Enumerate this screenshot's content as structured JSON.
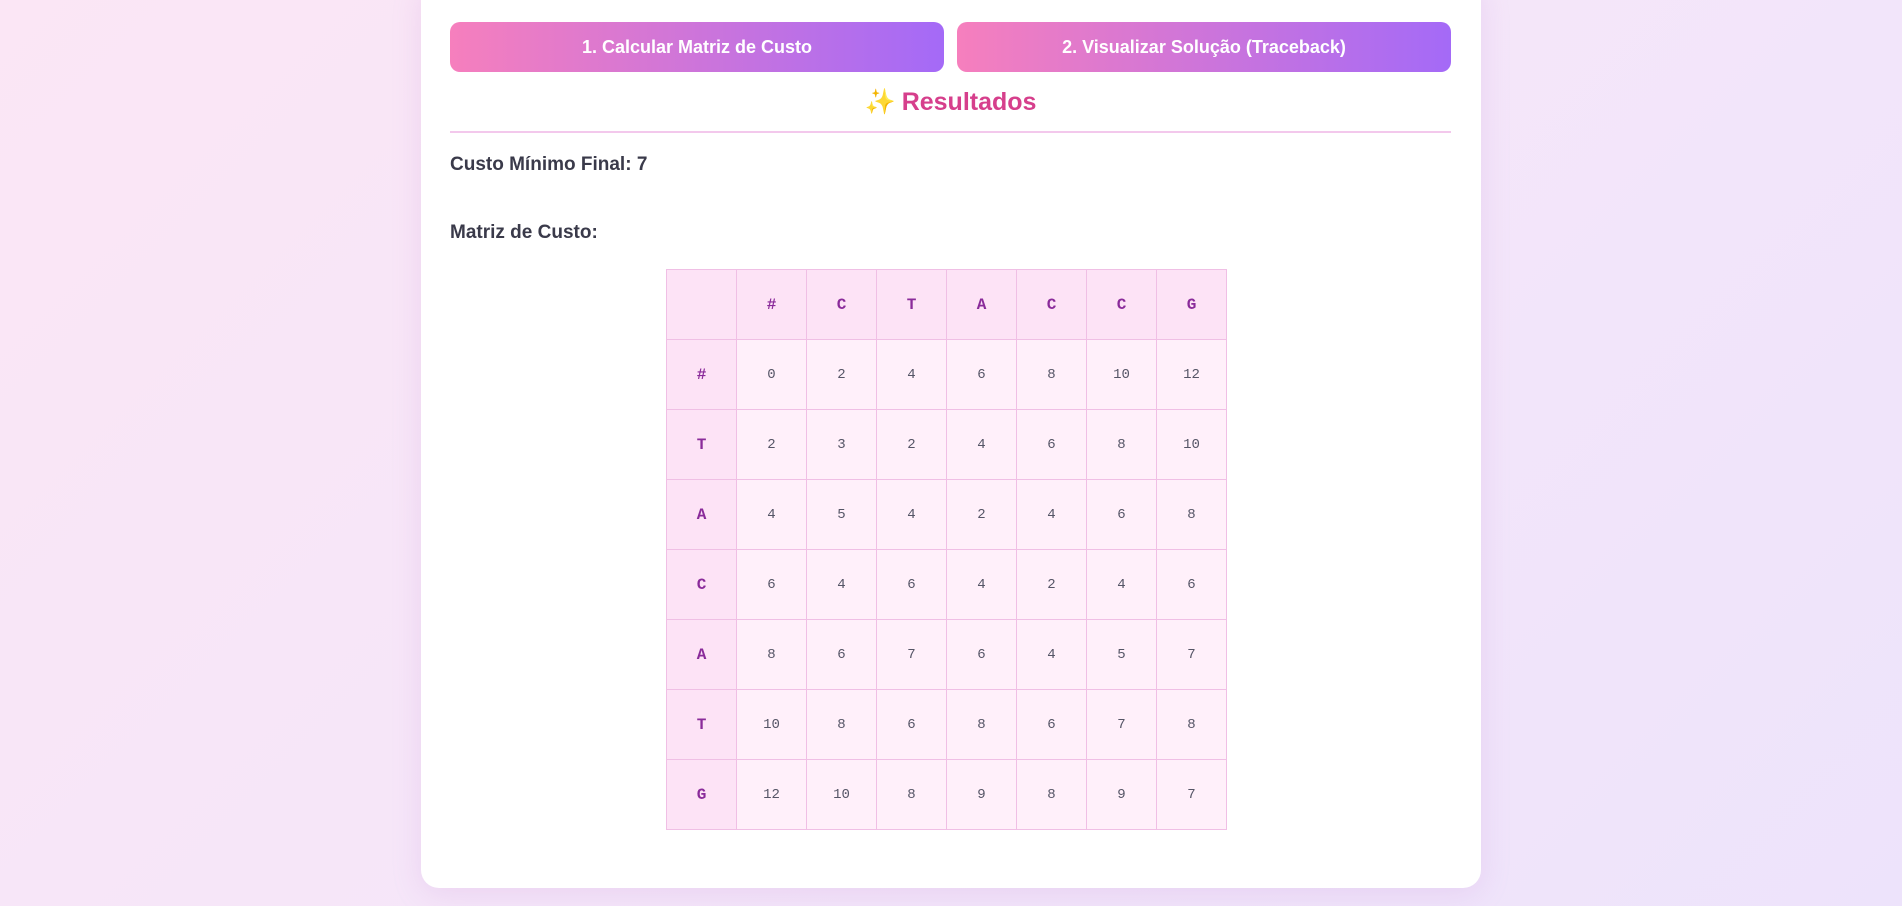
{
  "buttons": {
    "calculate_label": "1. Calcular Matriz de Custo",
    "traceback_label": "2. Visualizar Solução (Traceback)"
  },
  "results": {
    "sparkle_icon": "sparkles-icon",
    "sparkle_glyph": "✨",
    "title": "Resultados",
    "final_cost_label": "Custo Mínimo Final: 7",
    "matrix_label": "Matriz de Custo:"
  },
  "matrix": {
    "corner": "",
    "col_headers": [
      "#",
      "C",
      "T",
      "A",
      "C",
      "C",
      "G"
    ],
    "rows": [
      {
        "header": "#",
        "cells": [
          "0",
          "2",
          "4",
          "6",
          "8",
          "10",
          "12"
        ]
      },
      {
        "header": "T",
        "cells": [
          "2",
          "3",
          "2",
          "4",
          "6",
          "8",
          "10"
        ]
      },
      {
        "header": "A",
        "cells": [
          "4",
          "5",
          "4",
          "2",
          "4",
          "6",
          "8"
        ]
      },
      {
        "header": "C",
        "cells": [
          "6",
          "4",
          "6",
          "4",
          "2",
          "4",
          "6"
        ]
      },
      {
        "header": "A",
        "cells": [
          "8",
          "6",
          "7",
          "6",
          "4",
          "5",
          "7"
        ]
      },
      {
        "header": "T",
        "cells": [
          "10",
          "8",
          "6",
          "8",
          "6",
          "7",
          "8"
        ]
      },
      {
        "header": "G",
        "cells": [
          "12",
          "10",
          "8",
          "9",
          "8",
          "9",
          "7"
        ]
      }
    ]
  },
  "colors": {
    "button_gradient_start": "#f67fbd",
    "button_gradient_end": "#a46af7",
    "title_color": "#d63f8c",
    "header_cell_bg": "#fde3f6",
    "data_cell_bg": "#fff0fa",
    "header_text": "#8a2b9a"
  }
}
